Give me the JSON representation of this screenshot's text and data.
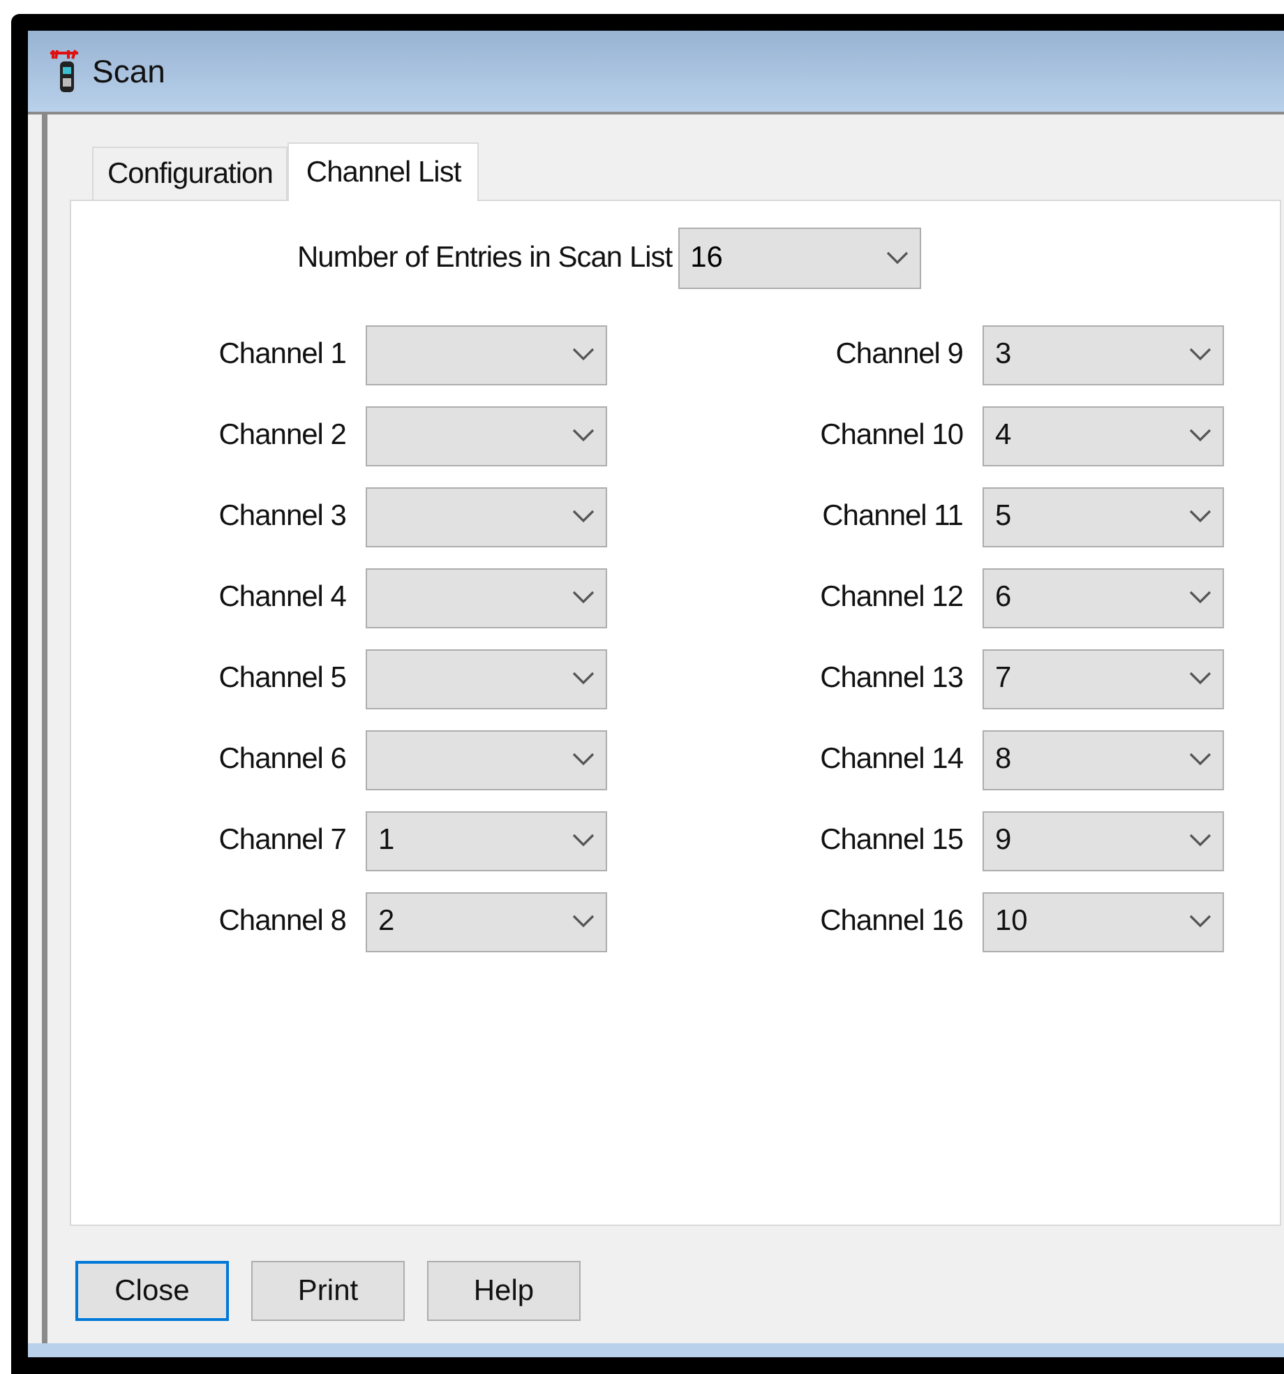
{
  "window": {
    "title": "Scan"
  },
  "tabs": [
    {
      "label": "Configuration",
      "selected": false
    },
    {
      "label": "Channel List",
      "selected": true
    }
  ],
  "entries": {
    "label": "Number of Entries in Scan List",
    "value": "16"
  },
  "channels": [
    {
      "label": "Channel 1"
    },
    {
      "label": "Channel 2"
    },
    {
      "label": "Channel 3"
    },
    {
      "label": "Channel 4"
    },
    {
      "label": "Channel 5"
    },
    {
      "label": "Channel 6"
    },
    {
      "label": "Channel 7",
      "value": "1"
    },
    {
      "label": "Channel 8",
      "value": "2"
    },
    {
      "label": "Channel 9",
      "value": "3"
    },
    {
      "label": "Channel 10",
      "value": "4"
    },
    {
      "label": "Channel 11",
      "value": "5"
    },
    {
      "label": "Channel 12",
      "value": "6"
    },
    {
      "label": "Channel 13",
      "value": "7"
    },
    {
      "label": "Channel 14",
      "value": "8"
    },
    {
      "label": "Channel 15",
      "value": "9"
    },
    {
      "label": "Channel 16",
      "value": "10"
    }
  ],
  "buttons": [
    {
      "label": "Close",
      "selected": true
    },
    {
      "label": "Print",
      "selected": false
    },
    {
      "label": "Help",
      "selected": false
    }
  ]
}
